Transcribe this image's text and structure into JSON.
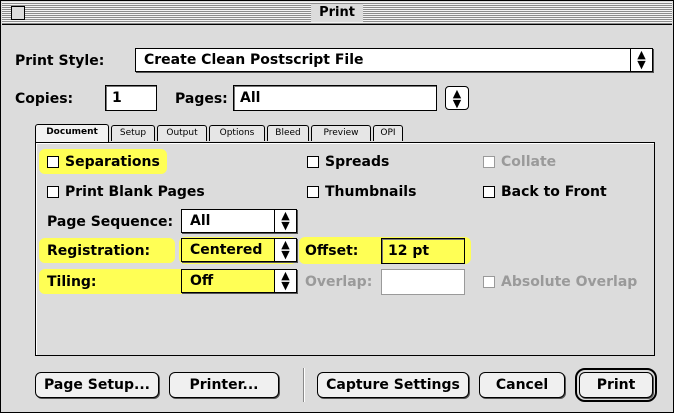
{
  "window": {
    "title": "Print"
  },
  "print_style": {
    "label": "Print Style:",
    "value": "Create Clean Postscript File"
  },
  "copies": {
    "label": "Copies:",
    "value": "1"
  },
  "pages": {
    "label": "Pages:",
    "value": "All"
  },
  "tabs": [
    {
      "label": "Document",
      "active": true
    },
    {
      "label": "Setup"
    },
    {
      "label": "Output"
    },
    {
      "label": "Options"
    },
    {
      "label": "Bleed"
    },
    {
      "label": "Preview"
    },
    {
      "label": "OPI"
    }
  ],
  "document_tab": {
    "separations": {
      "label": "Separations",
      "checked": false
    },
    "spreads": {
      "label": "Spreads",
      "checked": false
    },
    "collate": {
      "label": "Collate",
      "checked": false,
      "disabled": true
    },
    "print_blank_pages": {
      "label": "Print Blank Pages",
      "checked": false
    },
    "thumbnails": {
      "label": "Thumbnails",
      "checked": false
    },
    "back_to_front": {
      "label": "Back to Front",
      "checked": false
    },
    "page_sequence": {
      "label": "Page Sequence:",
      "value": "All"
    },
    "registration": {
      "label": "Registration:",
      "value": "Centered"
    },
    "offset": {
      "label": "Offset:",
      "value": "12 pt"
    },
    "tiling": {
      "label": "Tiling:",
      "value": "Off"
    },
    "overlap": {
      "label": "Overlap:",
      "value": "",
      "disabled": true
    },
    "absolute_overlap": {
      "label": "Absolute Overlap",
      "checked": false,
      "disabled": true
    }
  },
  "buttons": {
    "page_setup": "Page Setup...",
    "printer": "Printer...",
    "capture_settings": "Capture Settings",
    "cancel": "Cancel",
    "print": "Print"
  },
  "icons": {
    "popup_arrows": "up-down-arrows-icon"
  },
  "colors": {
    "highlight": "#ffff55",
    "window_bg": "#dcdcdc"
  }
}
